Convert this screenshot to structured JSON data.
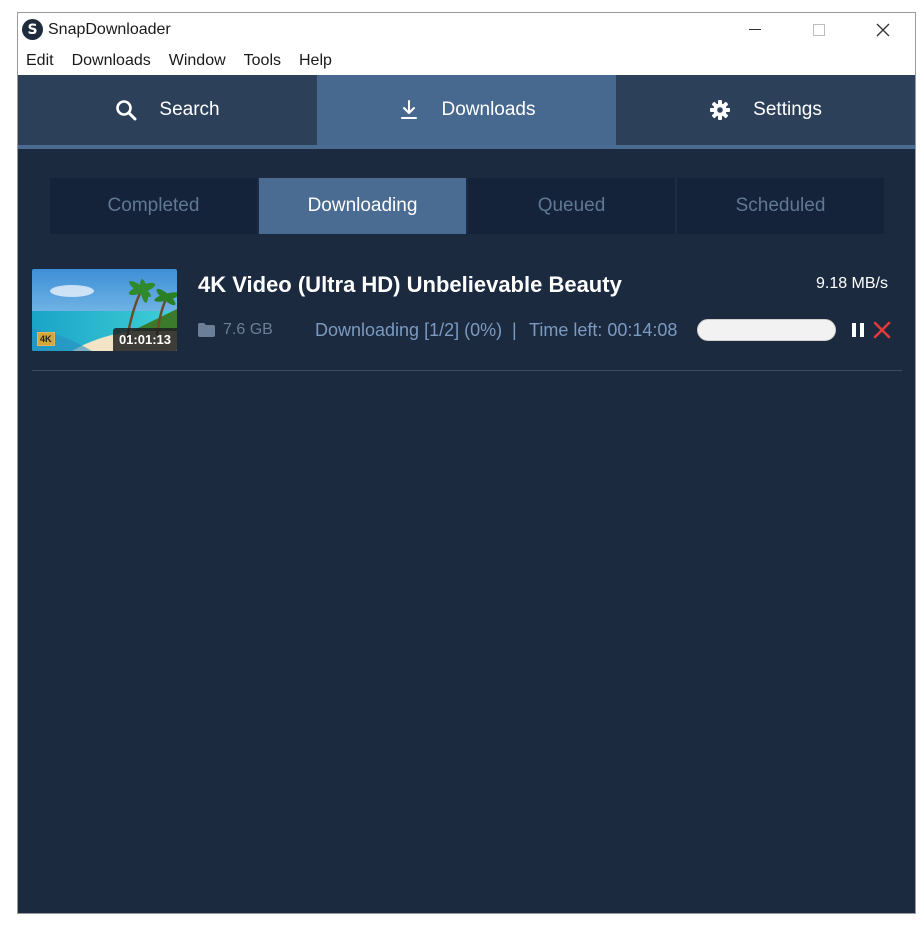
{
  "window": {
    "app_logo_letter": "S",
    "title": "SnapDownloader"
  },
  "menu": [
    "Edit",
    "Downloads",
    "Window",
    "Tools",
    "Help"
  ],
  "nav": {
    "tabs": [
      {
        "label": "Search",
        "icon": "search-icon"
      },
      {
        "label": "Downloads",
        "icon": "download-icon",
        "active": true
      },
      {
        "label": "Settings",
        "icon": "gear-icon"
      }
    ]
  },
  "subtabs": [
    {
      "label": "Completed"
    },
    {
      "label": "Downloading",
      "active": true
    },
    {
      "label": "Queued"
    },
    {
      "label": "Scheduled"
    }
  ],
  "download": {
    "title": "4K Video (Ultra HD) Unbelievable Beauty",
    "speed": "9.18 MB/s",
    "size": "7.6 GB",
    "status": "Downloading [1/2] (0%)",
    "separator": "|",
    "time_left": "Time left: 00:14:08",
    "progress_fraction": 0,
    "thumbnail": {
      "duration": "01:01:13",
      "badge": "4K"
    }
  },
  "colors": {
    "background": "#1b2a3e",
    "nav_bar": "#2c4159",
    "active_tab": "#48698f",
    "cancel_red": "#e03a3a",
    "status_text": "#7c9ac0"
  }
}
